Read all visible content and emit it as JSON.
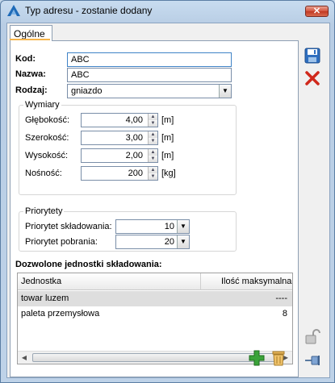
{
  "window": {
    "title": "Typ adresu - zostanie dodany"
  },
  "tabs": [
    {
      "label": "Ogólne"
    }
  ],
  "form": {
    "kod": {
      "label": "Kod:",
      "value": "ABC"
    },
    "nazwa": {
      "label": "Nazwa:",
      "value": "ABC"
    },
    "rodzaj": {
      "label": "Rodzaj:",
      "value": "gniazdo"
    }
  },
  "wymiary": {
    "title": "Wymiary",
    "fields": [
      {
        "label": "Głębokość:",
        "value": "4,00",
        "unit": "[m]"
      },
      {
        "label": "Szerokość:",
        "value": "3,00",
        "unit": "[m]"
      },
      {
        "label": "Wysokość:",
        "value": "2,00",
        "unit": "[m]"
      },
      {
        "label": "Nośność:",
        "value": "200",
        "unit": "[kg]"
      }
    ]
  },
  "priorytety": {
    "title": "Priorytety",
    "skladowania": {
      "label": "Priorytet składowania:",
      "value": "10"
    },
    "pobrania": {
      "label": "Priorytet pobrania:",
      "value": "20"
    }
  },
  "jednostki": {
    "title": "Dozwolone jednostki składowania:",
    "columns": [
      "Jednostka",
      "Ilość maksymalna"
    ],
    "rows": [
      {
        "jednostka": "towar luzem",
        "ilosc": "----"
      },
      {
        "jednostka": "paleta przemysłowa",
        "ilosc": "8"
      }
    ]
  },
  "colors": {
    "accent": "#f6b44b",
    "close": "#c13822",
    "add": "#3aa339",
    "save": "#2f6fc0"
  },
  "icons": [
    "app-logo-icon",
    "close-icon",
    "save-icon",
    "cancel-icon",
    "lock-icon",
    "pin-icon",
    "add-icon",
    "delete-icon"
  ]
}
